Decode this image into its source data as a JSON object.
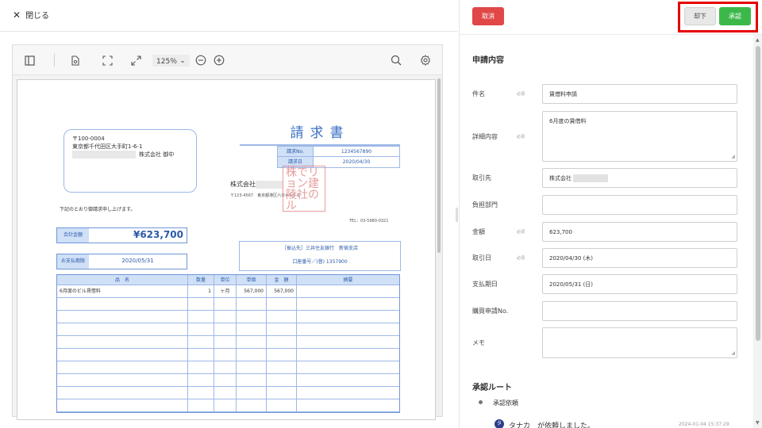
{
  "topbar": {
    "close_label": "閉じる"
  },
  "viewer": {
    "zoom": "125％",
    "invoice": {
      "postal": "〒100-0004",
      "address": "東京都千代田区大手町1-6-1",
      "customer_suffix": "株式会社 御中",
      "title": "請求書",
      "meta": [
        {
          "k": "請求No.",
          "v": "1234567890"
        },
        {
          "k": "請求日",
          "v": "2020/04/30"
        }
      ],
      "issuer_prefix": "株式会社",
      "issuer_address": "〒123-4567　東京都港区六本木1-1-1",
      "seal_text": "株でリョン建陵社のル",
      "tel": "TEL：03-5980-0321",
      "lead": "下記のとおり御請求申し上げます。",
      "total_label": "合計金額",
      "total_value": "¥623,700",
      "bank_line1": "［振込先］三井住友銀行　新宿支店",
      "bank_line2": "口座番号／(普) 1357900",
      "due_label": "お支払期限",
      "due_value": "2020/05/31",
      "headers": [
        "品　名",
        "数量",
        "単位",
        "単価",
        "金　額",
        "摘要"
      ],
      "rows": [
        [
          "6月度のビル賃借料",
          "1",
          "ヶ月",
          "567,000",
          "567,000",
          ""
        ]
      ]
    }
  },
  "panel": {
    "cancel_label": "取消",
    "reject_label": "却下",
    "approve_label": "承認",
    "section_title": "申請内容",
    "required_mark": "必須",
    "fields": {
      "subject": {
        "label": "件名",
        "value": "賃借料申請"
      },
      "detail": {
        "label": "詳細内容",
        "value": "6月度の賃借料"
      },
      "vendor": {
        "label": "取引先",
        "value": "株式会社"
      },
      "department": {
        "label": "負担部門",
        "value": ""
      },
      "amount": {
        "label": "金額",
        "value": "623,700"
      },
      "trade_date": {
        "label": "取引日",
        "value": "2020/04/30 (木)"
      },
      "due_date": {
        "label": "支払期日",
        "value": "2020/05/31 (日)"
      },
      "purchase_no": {
        "label": "購買申請No.",
        "value": ""
      },
      "memo": {
        "label": "メモ",
        "value": ""
      }
    },
    "route": {
      "title": "承認ルート",
      "step": "承認依頼",
      "avatar": "タ",
      "message": "タナカ　が依頼しました。",
      "time": "2024-01-04 15:37:29"
    }
  }
}
